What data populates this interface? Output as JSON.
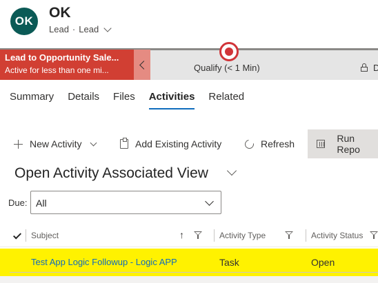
{
  "record": {
    "initials": "OK",
    "title": "OK",
    "entity": "Lead",
    "form": "Lead"
  },
  "bpf": {
    "process_name": "Lead to Opportunity Sale...",
    "process_status": "Active for less than one mi...",
    "stage_label": "Qualify  (< 1 Min)",
    "next_stage_initial": "D"
  },
  "tabs": [
    {
      "label": "Summary",
      "active": false
    },
    {
      "label": "Details",
      "active": false
    },
    {
      "label": "Files",
      "active": false
    },
    {
      "label": "Activities",
      "active": true
    },
    {
      "label": "Related",
      "active": false
    }
  ],
  "commands": {
    "new_activity": "New Activity",
    "add_existing": "Add Existing Activity",
    "refresh": "Refresh",
    "run_report": "Run Repo"
  },
  "view": {
    "title": "Open Activity Associated View"
  },
  "filter": {
    "label": "Due:",
    "value": "All"
  },
  "grid": {
    "columns": [
      "Subject",
      "Activity Type",
      "Activity Status"
    ],
    "rows": [
      {
        "subject": "Test App Logic Followup - Logic APP",
        "type": "Task",
        "status": "Open"
      }
    ]
  },
  "colors": {
    "accent": "#0f6cbd",
    "avatar": "#0b5a56",
    "process_bg": "#d13f33",
    "highlight_row": "#fff200"
  }
}
